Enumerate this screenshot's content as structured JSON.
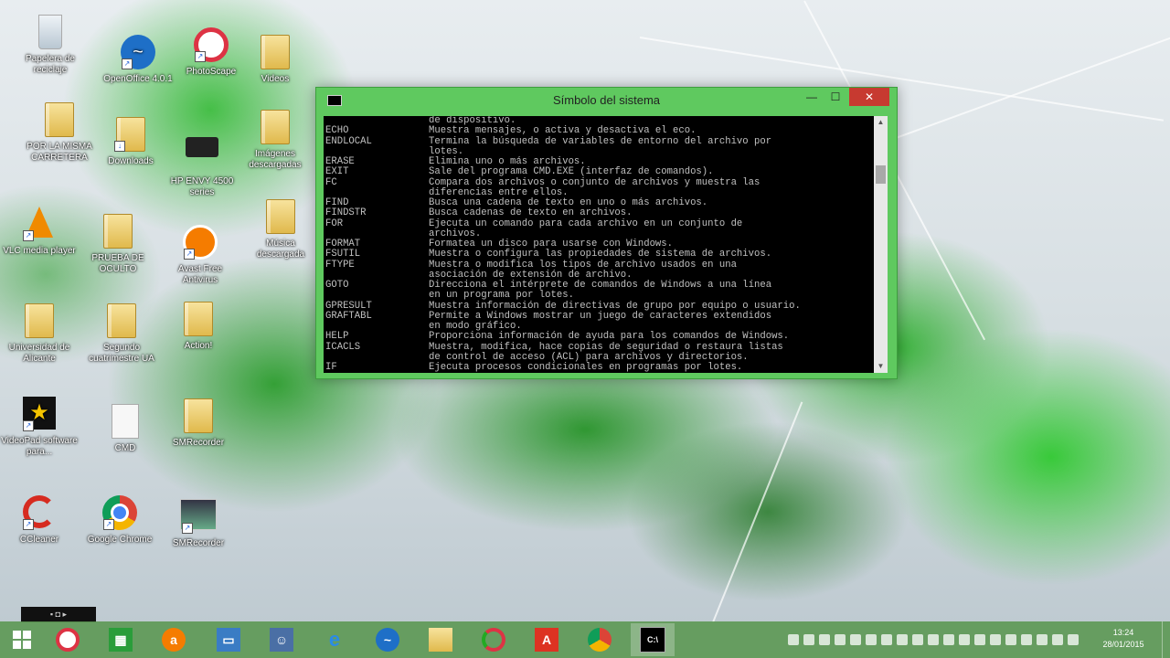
{
  "colors": {
    "window_frame": "#5fc95f",
    "close_button": "#c73a30",
    "console_bg": "#000000",
    "console_text": "#c0c0c0",
    "taskbar": "#5a9650"
  },
  "desktop_icons": [
    {
      "label": "Papelera de reciclaje",
      "icon": "recycle-bin-icon"
    },
    {
      "label": "OpenOffice 4.0.1",
      "icon": "openoffice-icon"
    },
    {
      "label": "PhotoScape",
      "icon": "photoscape-icon"
    },
    {
      "label": "Videos",
      "icon": "folder-icon"
    },
    {
      "label": "POR LA MISMA CARRETERA",
      "icon": "folder-icon"
    },
    {
      "label": "Downloads",
      "icon": "downloads-icon"
    },
    {
      "label": "HP ENVY 4500 series",
      "icon": "printer-icon"
    },
    {
      "label": "Imágenes descargadas",
      "icon": "folder-icon"
    },
    {
      "label": "VLC media player",
      "icon": "vlc-icon"
    },
    {
      "label": "PRUEBA DE OCULTO",
      "icon": "folder-icon"
    },
    {
      "label": "Avast Free Antivirus",
      "icon": "avast-icon"
    },
    {
      "label": "Música descargada",
      "icon": "folder-icon"
    },
    {
      "label": "Universidad de Alicante",
      "icon": "folder-icon"
    },
    {
      "label": "Segundo cuatrimestre UA",
      "icon": "folder-icon"
    },
    {
      "label": "Action!",
      "icon": "folder-icon"
    },
    {
      "label": "VideoPad software para...",
      "icon": "videopad-icon"
    },
    {
      "label": "CMD",
      "icon": "document-icon"
    },
    {
      "label": "SMRecorder",
      "icon": "folder-icon"
    },
    {
      "label": "CCleaner",
      "icon": "ccleaner-icon"
    },
    {
      "label": "Google Chrome",
      "icon": "chrome-icon"
    },
    {
      "label": "SMRecorder",
      "icon": "smrecorder-icon"
    }
  ],
  "window": {
    "title": "Símbolo del sistema",
    "minimize": "—",
    "maximize": "☐",
    "close": "✕",
    "scroll_up": "▲",
    "scroll_down": "▼"
  },
  "console": {
    "lines": [
      {
        "cmd": "",
        "text": "de dispositivo."
      },
      {
        "cmd": "ECHO",
        "text": "Muestra mensajes, o activa y desactiva el eco."
      },
      {
        "cmd": "ENDLOCAL",
        "text": "Termina la búsqueda de variables de entorno del archivo por"
      },
      {
        "cmd": "",
        "text": "lotes."
      },
      {
        "cmd": "ERASE",
        "text": "Elimina uno o más archivos."
      },
      {
        "cmd": "EXIT",
        "text": "Sale del programa CMD.EXE (interfaz de comandos)."
      },
      {
        "cmd": "FC",
        "text": "Compara dos archivos o conjunto de archivos y muestra las"
      },
      {
        "cmd": "",
        "text": "diferencias entre ellos."
      },
      {
        "cmd": "FIND",
        "text": "Busca una cadena de texto en uno o más archivos."
      },
      {
        "cmd": "FINDSTR",
        "text": "Busca cadenas de texto en archivos."
      },
      {
        "cmd": "FOR",
        "text": "Ejecuta un comando para cada archivo en un conjunto de"
      },
      {
        "cmd": "",
        "text": "archivos."
      },
      {
        "cmd": "FORMAT",
        "text": "Formatea un disco para usarse con Windows."
      },
      {
        "cmd": "FSUTIL",
        "text": "Muestra o configura las propiedades de sistema de archivos."
      },
      {
        "cmd": "FTYPE",
        "text": "Muestra o modifica los tipos de archivo usados en una"
      },
      {
        "cmd": "",
        "text": "asociación de extensión de archivo."
      },
      {
        "cmd": "GOTO",
        "text": "Direcciona el intérprete de comandos de Windows a una línea"
      },
      {
        "cmd": "",
        "text": "en un programa por lotes."
      },
      {
        "cmd": "GPRESULT",
        "text": "Muestra información de directivas de grupo por equipo o usuario."
      },
      {
        "cmd": "GRAFTABL",
        "text": "Permite a Windows mostrar un juego de caracteres extendidos"
      },
      {
        "cmd": "",
        "text": "en modo gráfico."
      },
      {
        "cmd": "HELP",
        "text": "Proporciona información de ayuda para los comandos de Windows."
      },
      {
        "cmd": "ICACLS",
        "text": "Muestra, modifica, hace copias de seguridad o restaura listas"
      },
      {
        "cmd": "",
        "text": "de control de acceso (ACL) para archivos y directorios."
      },
      {
        "cmd": "IF",
        "text": "Ejecuta procesos condicionales en programas por lotes."
      }
    ]
  },
  "taskbar": {
    "start": "start-icon",
    "apps": [
      "photoscape-icon",
      "store-icon",
      "avast-icon",
      "monitor-icon",
      "people-icon",
      "internet-explorer-icon",
      "openoffice-icon",
      "file-explorer-icon",
      "photoscape-icon",
      "acrobat-icon",
      "chrome-icon",
      "command-prompt-icon"
    ],
    "clock_time": "13:24",
    "clock_date": "28/01/2015",
    "tooltip": "▪ ◘ ▸"
  }
}
